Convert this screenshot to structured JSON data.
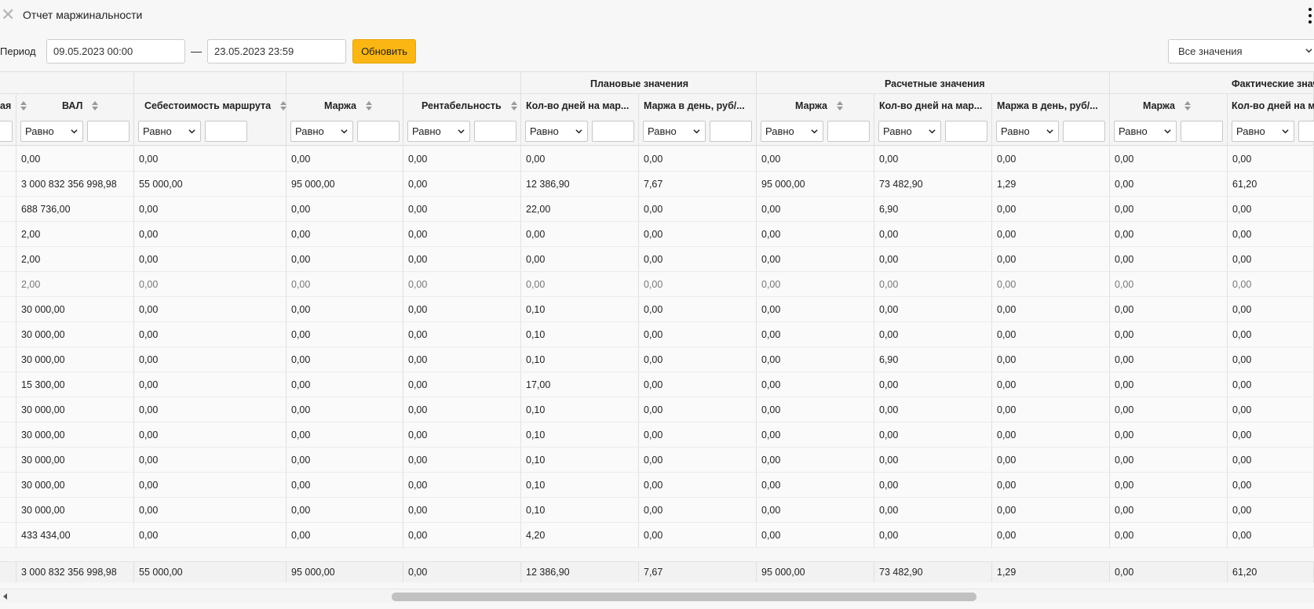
{
  "window": {
    "title": "Отчет маржинальности"
  },
  "toolbar": {
    "period_label": "Период",
    "date_from": "09.05.2023 00:00",
    "date_to": "23.05.2023 23:59",
    "dash": "—",
    "refresh_label": "Обновить",
    "values_filter": "Все значения"
  },
  "table": {
    "groups": [
      "Плановые значения",
      "Расчетные значения",
      "Фактические значения"
    ],
    "groups_visible": [
      "Плановые значения",
      "Расчетные значения",
      "Фактические знач"
    ],
    "columns": [
      "ая",
      "ВАЛ",
      "Себестоимость маршрута",
      "Маржа",
      "Рентабельность",
      "Кол-во дней на мар...",
      "Маржа в день, руб/...",
      "Маржа",
      "Кол-во дней на мар...",
      "Маржа в день, руб/...",
      "Маржа",
      "Кол-во дней на ма"
    ],
    "filter_operator": "Равно",
    "rows": [
      [
        "0,00",
        "0,00",
        "0,00",
        "0,00",
        "0,00",
        "0,00",
        "0,00",
        "0,00",
        "0,00",
        "0,00",
        "0,00"
      ],
      [
        "3 000 832 356 998,98",
        "55 000,00",
        "95 000,00",
        "0,00",
        "12 386,90",
        "7,67",
        "95 000,00",
        "73 482,90",
        "1,29",
        "0,00",
        "61,20"
      ],
      [
        "688 736,00",
        "0,00",
        "0,00",
        "0,00",
        "22,00",
        "0,00",
        "0,00",
        "6,90",
        "0,00",
        "0,00",
        "0,00"
      ],
      [
        "2,00",
        "0,00",
        "0,00",
        "0,00",
        "0,00",
        "0,00",
        "0,00",
        "0,00",
        "0,00",
        "0,00",
        "0,00"
      ],
      [
        "2,00",
        "0,00",
        "0,00",
        "0,00",
        "0,00",
        "0,00",
        "0,00",
        "0,00",
        "0,00",
        "0,00",
        "0,00"
      ],
      [
        "2,00",
        "0,00",
        "0,00",
        "0,00",
        "0,00",
        "0,00",
        "0,00",
        "0,00",
        "0,00",
        "0,00",
        "0,00"
      ],
      [
        "30 000,00",
        "0,00",
        "0,00",
        "0,00",
        "0,10",
        "0,00",
        "0,00",
        "0,00",
        "0,00",
        "0,00",
        "0,00"
      ],
      [
        "30 000,00",
        "0,00",
        "0,00",
        "0,00",
        "0,10",
        "0,00",
        "0,00",
        "0,00",
        "0,00",
        "0,00",
        "0,00"
      ],
      [
        "30 000,00",
        "0,00",
        "0,00",
        "0,00",
        "0,10",
        "0,00",
        "0,00",
        "6,90",
        "0,00",
        "0,00",
        "0,00"
      ],
      [
        "15 300,00",
        "0,00",
        "0,00",
        "0,00",
        "17,00",
        "0,00",
        "0,00",
        "0,00",
        "0,00",
        "0,00",
        "0,00"
      ],
      [
        "30 000,00",
        "0,00",
        "0,00",
        "0,00",
        "0,10",
        "0,00",
        "0,00",
        "0,00",
        "0,00",
        "0,00",
        "0,00"
      ],
      [
        "30 000,00",
        "0,00",
        "0,00",
        "0,00",
        "0,10",
        "0,00",
        "0,00",
        "0,00",
        "0,00",
        "0,00",
        "0,00"
      ],
      [
        "30 000,00",
        "0,00",
        "0,00",
        "0,00",
        "0,10",
        "0,00",
        "0,00",
        "0,00",
        "0,00",
        "0,00",
        "0,00"
      ],
      [
        "30 000,00",
        "0,00",
        "0,00",
        "0,00",
        "0,10",
        "0,00",
        "0,00",
        "0,00",
        "0,00",
        "0,00",
        "0,00"
      ],
      [
        "30 000,00",
        "0,00",
        "0,00",
        "0,00",
        "0,10",
        "0,00",
        "0,00",
        "0,00",
        "0,00",
        "0,00",
        "0,00"
      ],
      [
        "433 434,00",
        "0,00",
        "0,00",
        "0,00",
        "4,20",
        "0,00",
        "0,00",
        "0,00",
        "0,00",
        "0,00",
        "0,00"
      ]
    ],
    "totals": [
      "3 000 832 356 998,98",
      "55 000,00",
      "95 000,00",
      "0,00",
      "12 386,90",
      "7,67",
      "95 000,00",
      "73 482,90",
      "1,29",
      "0,00",
      "61,20"
    ]
  },
  "icons": {
    "close": "close-icon",
    "menu": "more-vertical-icon",
    "sort": "sort-icon",
    "dropdown": "chevron-down-icon",
    "scroll_left": "arrow-left-icon"
  },
  "colors": {
    "accent": "#fbb614",
    "background": "#f7f7f7",
    "border": "#e0e0e0"
  }
}
